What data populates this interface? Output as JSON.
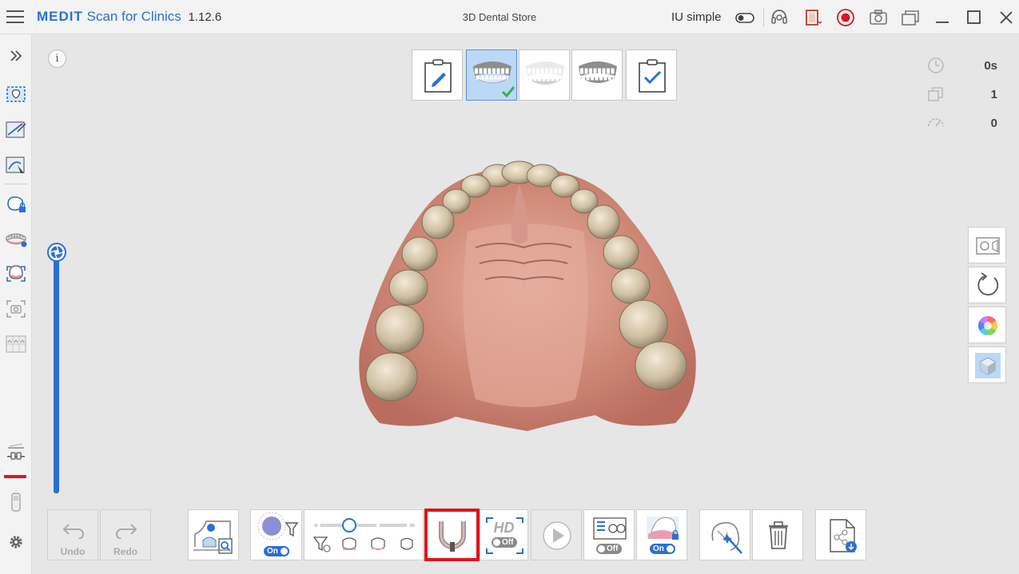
{
  "titlebar": {
    "brand": "MEDIT",
    "app_name": "Scan for Clinics",
    "version": "1.12.6",
    "store": "3D Dental Store",
    "mode_label": "IU simple",
    "icons": [
      "menu-icon",
      "toggle-switch",
      "headset-icon",
      "record-area-icon",
      "record-icon",
      "camera-icon",
      "window-capture-icon",
      "minimize-icon",
      "maximize-icon",
      "close-icon"
    ]
  },
  "leftbar": {
    "icons": [
      "expand-icon",
      "select-area-icon",
      "edit-margin-icon",
      "trim-icon",
      "lock-area-icon",
      "arch-icon",
      "undercut-icon",
      "capture-icon",
      "teeth-grid-icon",
      "filter-icon",
      "settings-icon"
    ]
  },
  "info": {
    "label": "i"
  },
  "stages": [
    {
      "name": "stage-prep",
      "icon": "clipboard-edit-icon",
      "active": false
    },
    {
      "name": "stage-maxilla",
      "icon": "upper-jaw-icon",
      "active": true
    },
    {
      "name": "stage-mandible",
      "icon": "lower-jaw-icon",
      "active": false
    },
    {
      "name": "stage-occlusion",
      "icon": "occlusion-icon",
      "active": false
    },
    {
      "name": "stage-complete",
      "icon": "clipboard-check-icon",
      "active": false
    }
  ],
  "stats": {
    "time": "0s",
    "shots": "1",
    "speed": "0"
  },
  "right_tools": [
    "video-icon",
    "rotate-icon",
    "color-wheel-icon",
    "cube-icon"
  ],
  "bottom": {
    "undo": "Undo",
    "redo": "Redo",
    "filter_toggle": "On",
    "hd_label": "HD",
    "hd_toggle": "Off",
    "ai_toggle": "Off",
    "lock_toggle": "On"
  },
  "colors": {
    "accent": "#2a6fd6",
    "highlight": "#e0141b",
    "record": "#e0141b"
  }
}
